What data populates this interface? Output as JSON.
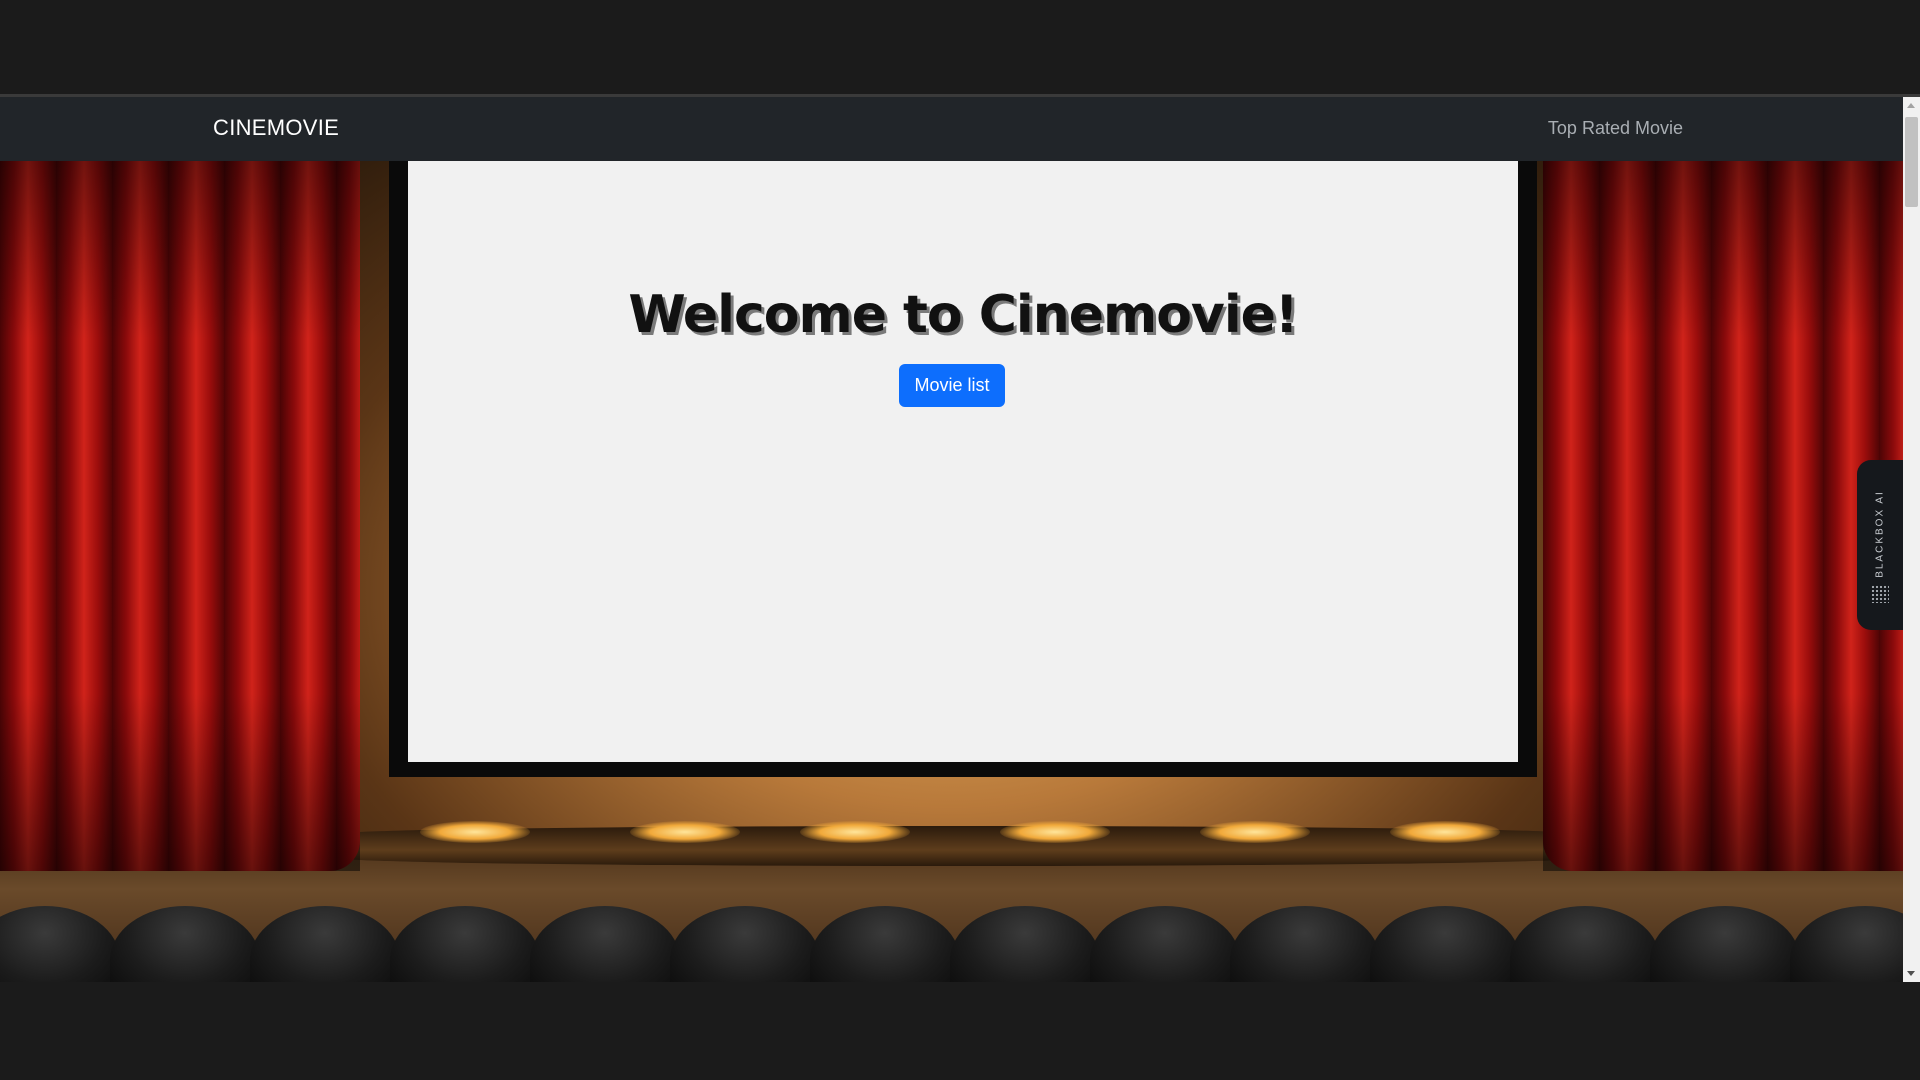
{
  "navbar": {
    "brand": "CINEMOVIE",
    "links": [
      {
        "label": "Top Rated Movie"
      }
    ]
  },
  "hero": {
    "title": "Welcome to Cinemovie!",
    "button_label": "Movie list"
  },
  "sidebar_widget": {
    "label": "BLACKBOX AI",
    "icon": "dots-grid-icon"
  },
  "colors": {
    "navbar_bg": "#212529",
    "primary_button": "#0d6efd",
    "screen": "#f1f1f1"
  }
}
